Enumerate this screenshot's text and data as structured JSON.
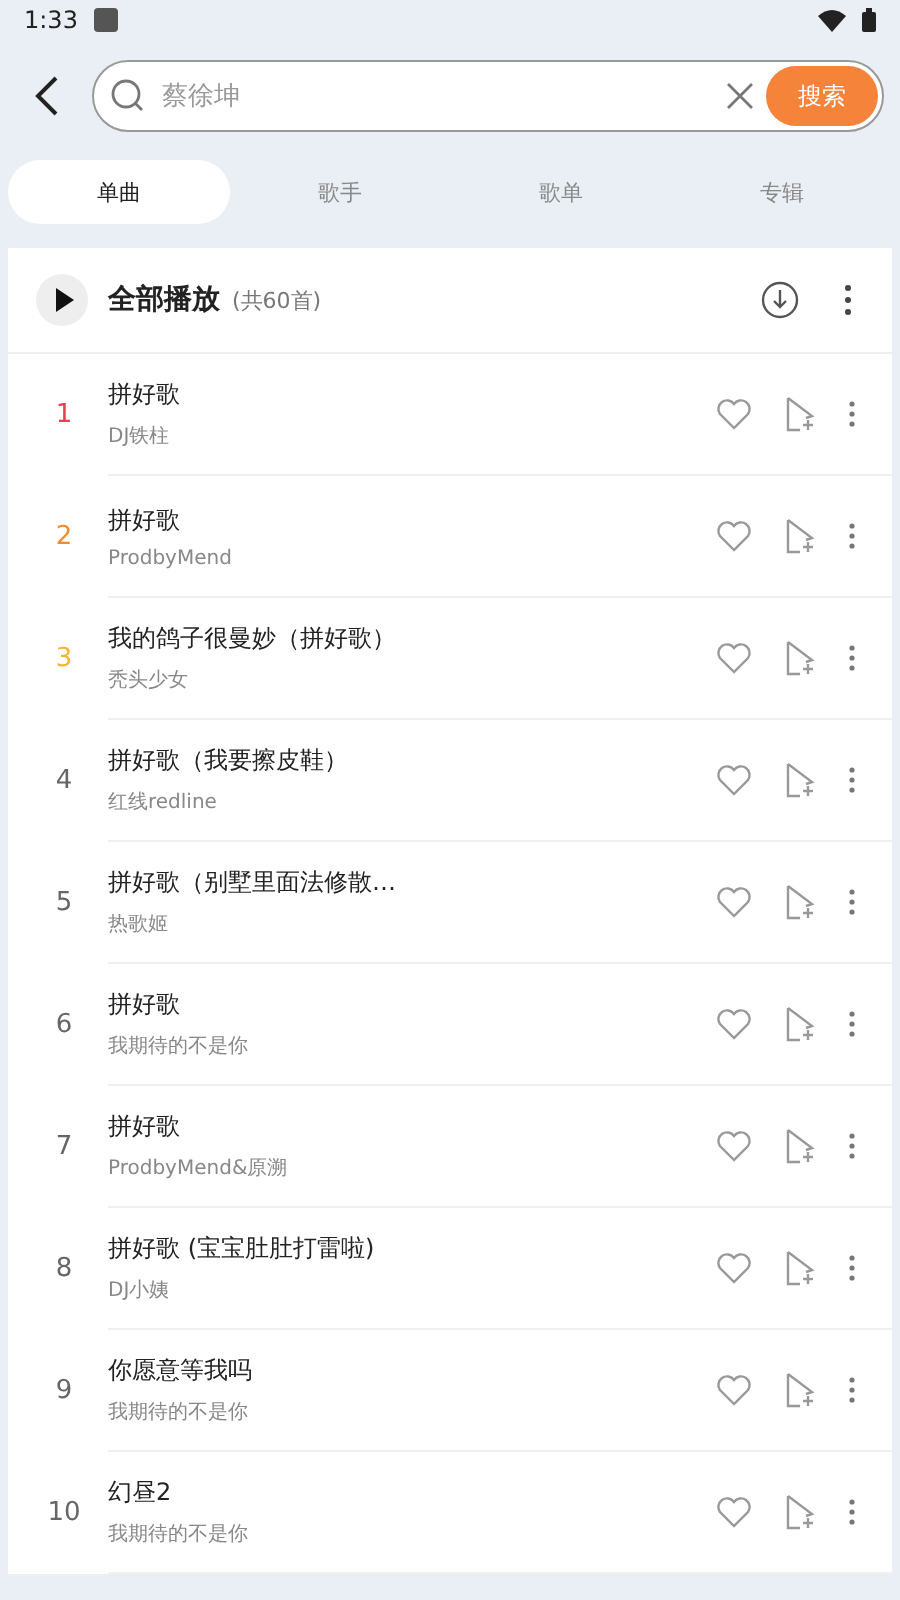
{
  "status_bar": {
    "time": "1:33"
  },
  "search": {
    "placeholder": "蔡徐坤",
    "button": "搜索"
  },
  "tabs": [
    {
      "label": "单曲",
      "selected": true
    },
    {
      "label": "歌手",
      "selected": false
    },
    {
      "label": "歌单",
      "selected": false
    },
    {
      "label": "专辑",
      "selected": false
    }
  ],
  "play_all": {
    "label": "全部播放",
    "count": "(共60首)"
  },
  "songs": [
    {
      "rank": "1",
      "color": "#e0424f",
      "title": "拼好歌",
      "artist": "DJ铁柱"
    },
    {
      "rank": "2",
      "color": "#f08c2e",
      "title": "拼好歌",
      "artist": "ProdbyMend"
    },
    {
      "rank": "3",
      "color": "#f2b632",
      "title": "我的鸽子很曼妙（拼好歌）",
      "artist": "秃头少女"
    },
    {
      "rank": "4",
      "color": "#666666",
      "title": "拼好歌（我要擦皮鞋）",
      "artist": "红线redline"
    },
    {
      "rank": "5",
      "color": "#666666",
      "title": "拼好歌（别墅里面法修散…",
      "artist": "热歌姬"
    },
    {
      "rank": "6",
      "color": "#666666",
      "title": "拼好歌",
      "artist": "我期待的不是你"
    },
    {
      "rank": "7",
      "color": "#666666",
      "title": "拼好歌",
      "artist": "ProdbyMend&原溯"
    },
    {
      "rank": "8",
      "color": "#666666",
      "title": "拼好歌 (宝宝肚肚打雷啦)",
      "artist": "DJ小姨"
    },
    {
      "rank": "9",
      "color": "#666666",
      "title": "你愿意等我吗",
      "artist": "我期待的不是你"
    },
    {
      "rank": "10",
      "color": "#666666",
      "title": "幻昼2",
      "artist": "我期待的不是你"
    }
  ]
}
